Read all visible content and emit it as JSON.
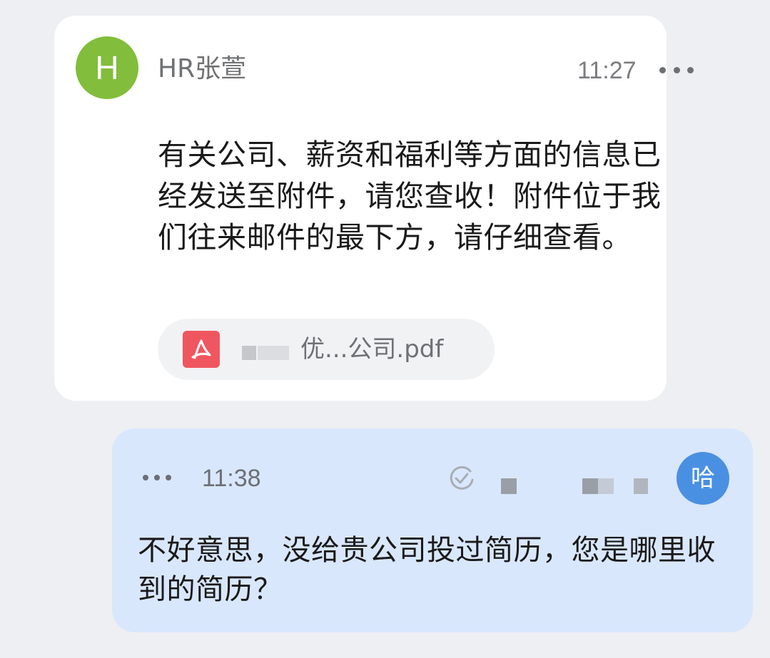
{
  "incoming": {
    "avatar_letter": "H",
    "sender_name": "HR张萱",
    "time": "11:27",
    "more_icon": "more-horizontal-icon",
    "body": "有关公司、薪资和福利等方面的信息已经发送至附件，请您查收！附件位于我们往来邮件的最下方，请仔细查看。",
    "attachment": {
      "icon": "pdf-icon",
      "file_name": "优...公司.pdf"
    }
  },
  "outgoing": {
    "more_icon": "more-horizontal-icon",
    "time": "11:38",
    "status_icon": "read-check-icon",
    "avatar_text": "哈",
    "body": "不好意思，没给贵公司投过简历，您是哪里收到的简历？"
  },
  "colors": {
    "background": "#eeeff3",
    "incoming_card": "#ffffff",
    "outgoing_card": "#d9e7fc",
    "incoming_avatar": "#82bd3c",
    "outgoing_avatar": "#4a90e2",
    "pdf_icon": "#f05660"
  }
}
